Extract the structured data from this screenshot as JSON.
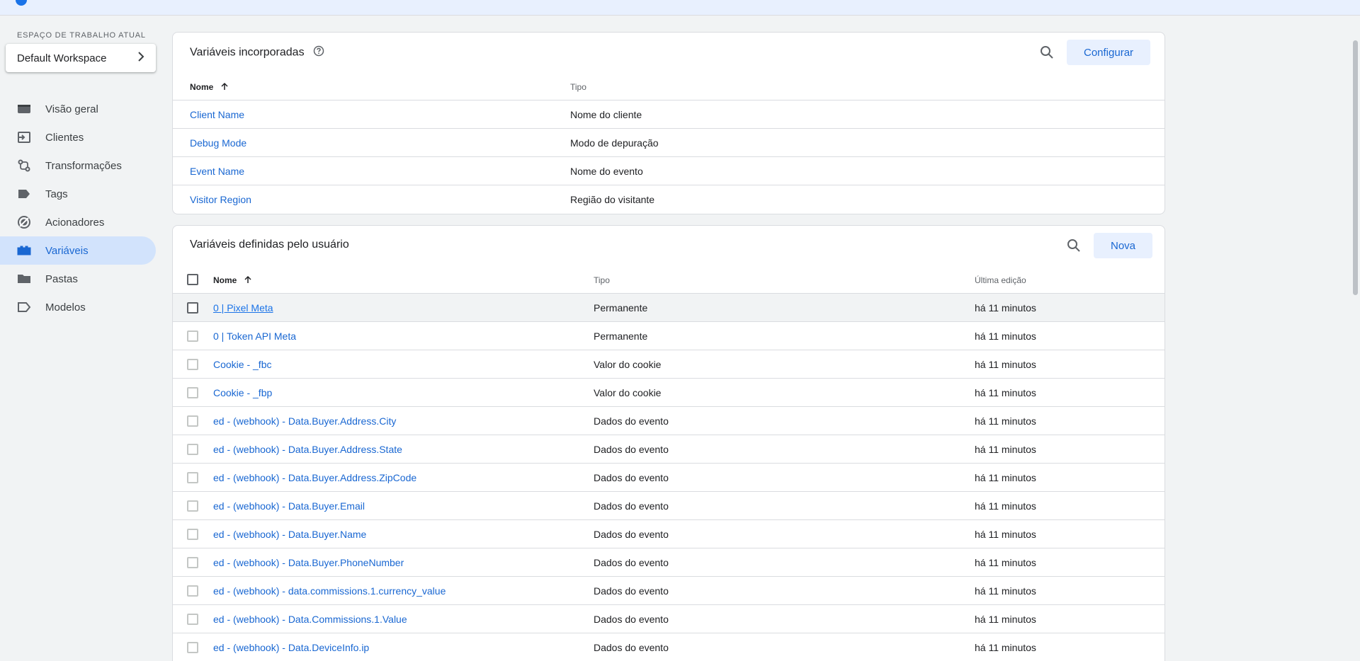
{
  "workspace": {
    "label": "ESPAÇO DE TRABALHO ATUAL",
    "name": "Default Workspace"
  },
  "nav": {
    "items": [
      {
        "label": "Visão geral",
        "icon": "overview-icon"
      },
      {
        "label": "Clientes",
        "icon": "clients-icon"
      },
      {
        "label": "Transformações",
        "icon": "transformations-icon"
      },
      {
        "label": "Tags",
        "icon": "tag-icon"
      },
      {
        "label": "Acionadores",
        "icon": "triggers-icon"
      },
      {
        "label": "Variáveis",
        "icon": "variables-icon",
        "active": true
      },
      {
        "label": "Pastas",
        "icon": "folder-icon"
      },
      {
        "label": "Modelos",
        "icon": "templates-icon"
      }
    ]
  },
  "builtin": {
    "title": "Variáveis incorporadas",
    "configure_label": "Configurar",
    "col_name": "Nome",
    "col_type": "Tipo",
    "rows": [
      {
        "name": "Client Name",
        "type": "Nome do cliente"
      },
      {
        "name": "Debug Mode",
        "type": "Modo de depuração"
      },
      {
        "name": "Event Name",
        "type": "Nome do evento"
      },
      {
        "name": "Visitor Region",
        "type": "Região do visitante"
      }
    ]
  },
  "user": {
    "title": "Variáveis definidas pelo usuário",
    "new_label": "Nova",
    "col_name": "Nome",
    "col_type": "Tipo",
    "col_edited": "Última edição",
    "rows": [
      {
        "name": "0 | Pixel Meta",
        "type": "Permanente",
        "edited": "há 11 minutos"
      },
      {
        "name": "0 | Token API Meta",
        "type": "Permanente",
        "edited": "há 11 minutos"
      },
      {
        "name": "Cookie - _fbc",
        "type": "Valor do cookie",
        "edited": "há 11 minutos"
      },
      {
        "name": "Cookie - _fbp",
        "type": "Valor do cookie",
        "edited": "há 11 minutos"
      },
      {
        "name": "ed - (webhook) - Data.Buyer.Address.City",
        "type": "Dados do evento",
        "edited": "há 11 minutos"
      },
      {
        "name": "ed - (webhook) - Data.Buyer.Address.State",
        "type": "Dados do evento",
        "edited": "há 11 minutos"
      },
      {
        "name": "ed - (webhook) - Data.Buyer.Address.ZipCode",
        "type": "Dados do evento",
        "edited": "há 11 minutos"
      },
      {
        "name": "ed - (webhook) - Data.Buyer.Email",
        "type": "Dados do evento",
        "edited": "há 11 minutos"
      },
      {
        "name": "ed - (webhook) - Data.Buyer.Name",
        "type": "Dados do evento",
        "edited": "há 11 minutos"
      },
      {
        "name": "ed - (webhook) - Data.Buyer.PhoneNumber",
        "type": "Dados do evento",
        "edited": "há 11 minutos"
      },
      {
        "name": "ed - (webhook) - data.commissions.1.currency_value",
        "type": "Dados do evento",
        "edited": "há 11 minutos"
      },
      {
        "name": "ed - (webhook) - Data.Commissions.1.Value",
        "type": "Dados do evento",
        "edited": "há 11 minutos"
      },
      {
        "name": "ed - (webhook) - Data.DeviceInfo.ip",
        "type": "Dados do evento",
        "edited": "há 11 minutos"
      }
    ]
  }
}
